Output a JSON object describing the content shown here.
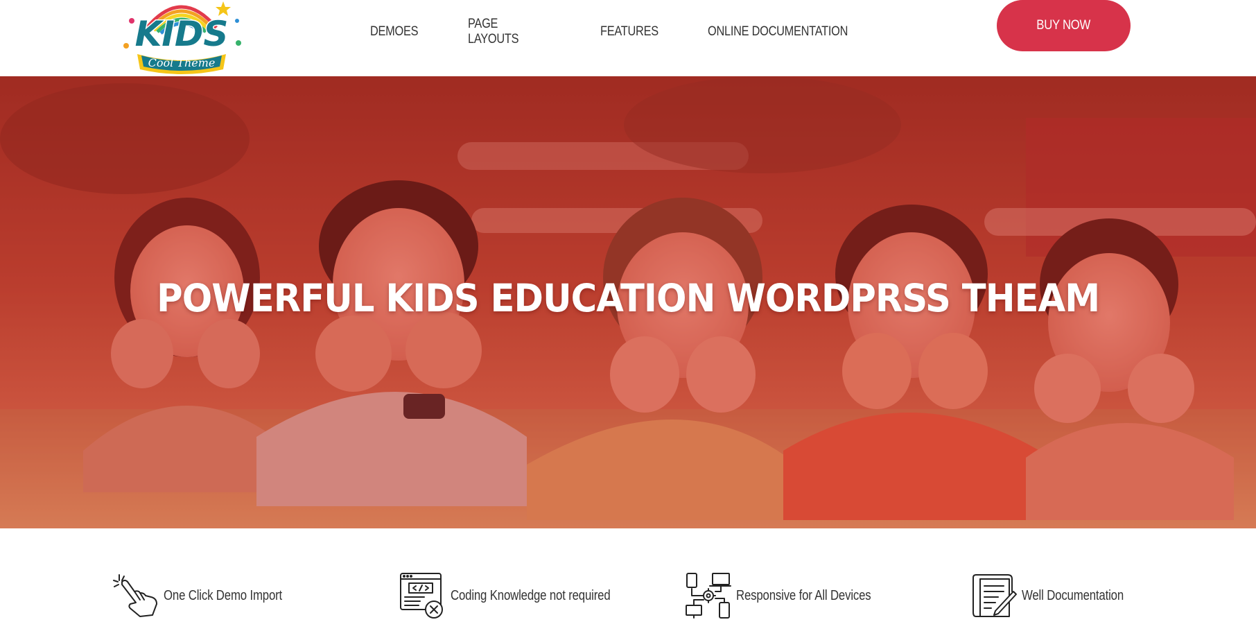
{
  "header": {
    "logo": {
      "word": "KIDS",
      "tagline": "Cool Theme"
    },
    "nav": [
      {
        "label": "DEMOES"
      },
      {
        "label": "PAGE LAYOUTS"
      },
      {
        "label": "FEATURES"
      },
      {
        "label": "ONLINE DOCUMENTATION"
      }
    ],
    "buy_label": "BUY NOW"
  },
  "hero": {
    "title": "POWERFUL KIDS EDUCATION WORDPRSS THEAM",
    "overlay_color": "#c42f2f"
  },
  "features": [
    {
      "label": "One Click Demo Import",
      "icon": "hand-pointer-click-icon"
    },
    {
      "label": "Coding Knowledge not required",
      "icon": "code-window-icon"
    },
    {
      "label": "Responsive for All Devices",
      "icon": "devices-network-icon"
    },
    {
      "label": "Well Documentation",
      "icon": "document-pen-icon"
    }
  ],
  "colors": {
    "accent": "#d7334a",
    "logo_teal": "#167a8c",
    "text": "#333333"
  }
}
